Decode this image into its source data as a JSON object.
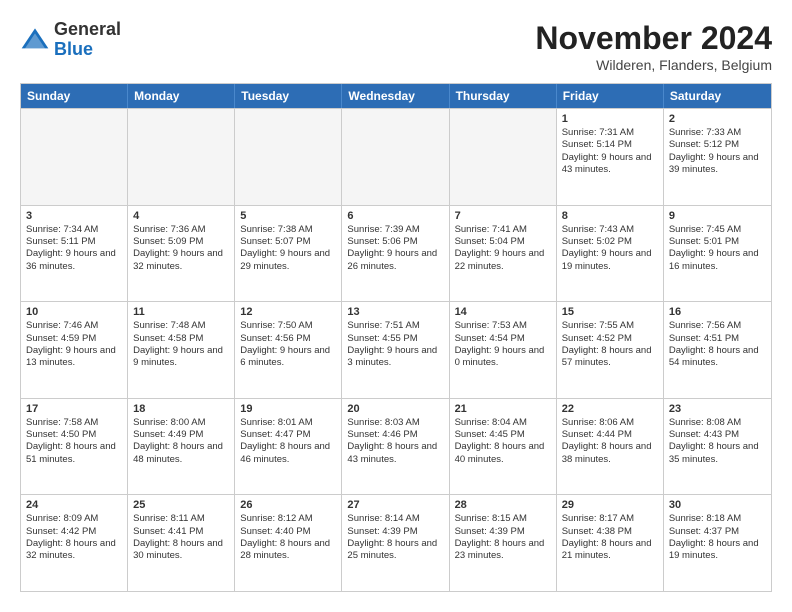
{
  "header": {
    "logo_general": "General",
    "logo_blue": "Blue",
    "month_title": "November 2024",
    "location": "Wilderen, Flanders, Belgium"
  },
  "days_of_week": [
    "Sunday",
    "Monday",
    "Tuesday",
    "Wednesday",
    "Thursday",
    "Friday",
    "Saturday"
  ],
  "rows": [
    [
      {
        "day": "",
        "empty": true
      },
      {
        "day": "",
        "empty": true
      },
      {
        "day": "",
        "empty": true
      },
      {
        "day": "",
        "empty": true
      },
      {
        "day": "",
        "empty": true
      },
      {
        "day": "1",
        "sunrise": "Sunrise: 7:31 AM",
        "sunset": "Sunset: 5:14 PM",
        "daylight": "Daylight: 9 hours and 43 minutes."
      },
      {
        "day": "2",
        "sunrise": "Sunrise: 7:33 AM",
        "sunset": "Sunset: 5:12 PM",
        "daylight": "Daylight: 9 hours and 39 minutes."
      }
    ],
    [
      {
        "day": "3",
        "sunrise": "Sunrise: 7:34 AM",
        "sunset": "Sunset: 5:11 PM",
        "daylight": "Daylight: 9 hours and 36 minutes."
      },
      {
        "day": "4",
        "sunrise": "Sunrise: 7:36 AM",
        "sunset": "Sunset: 5:09 PM",
        "daylight": "Daylight: 9 hours and 32 minutes."
      },
      {
        "day": "5",
        "sunrise": "Sunrise: 7:38 AM",
        "sunset": "Sunset: 5:07 PM",
        "daylight": "Daylight: 9 hours and 29 minutes."
      },
      {
        "day": "6",
        "sunrise": "Sunrise: 7:39 AM",
        "sunset": "Sunset: 5:06 PM",
        "daylight": "Daylight: 9 hours and 26 minutes."
      },
      {
        "day": "7",
        "sunrise": "Sunrise: 7:41 AM",
        "sunset": "Sunset: 5:04 PM",
        "daylight": "Daylight: 9 hours and 22 minutes."
      },
      {
        "day": "8",
        "sunrise": "Sunrise: 7:43 AM",
        "sunset": "Sunset: 5:02 PM",
        "daylight": "Daylight: 9 hours and 19 minutes."
      },
      {
        "day": "9",
        "sunrise": "Sunrise: 7:45 AM",
        "sunset": "Sunset: 5:01 PM",
        "daylight": "Daylight: 9 hours and 16 minutes."
      }
    ],
    [
      {
        "day": "10",
        "sunrise": "Sunrise: 7:46 AM",
        "sunset": "Sunset: 4:59 PM",
        "daylight": "Daylight: 9 hours and 13 minutes."
      },
      {
        "day": "11",
        "sunrise": "Sunrise: 7:48 AM",
        "sunset": "Sunset: 4:58 PM",
        "daylight": "Daylight: 9 hours and 9 minutes."
      },
      {
        "day": "12",
        "sunrise": "Sunrise: 7:50 AM",
        "sunset": "Sunset: 4:56 PM",
        "daylight": "Daylight: 9 hours and 6 minutes."
      },
      {
        "day": "13",
        "sunrise": "Sunrise: 7:51 AM",
        "sunset": "Sunset: 4:55 PM",
        "daylight": "Daylight: 9 hours and 3 minutes."
      },
      {
        "day": "14",
        "sunrise": "Sunrise: 7:53 AM",
        "sunset": "Sunset: 4:54 PM",
        "daylight": "Daylight: 9 hours and 0 minutes."
      },
      {
        "day": "15",
        "sunrise": "Sunrise: 7:55 AM",
        "sunset": "Sunset: 4:52 PM",
        "daylight": "Daylight: 8 hours and 57 minutes."
      },
      {
        "day": "16",
        "sunrise": "Sunrise: 7:56 AM",
        "sunset": "Sunset: 4:51 PM",
        "daylight": "Daylight: 8 hours and 54 minutes."
      }
    ],
    [
      {
        "day": "17",
        "sunrise": "Sunrise: 7:58 AM",
        "sunset": "Sunset: 4:50 PM",
        "daylight": "Daylight: 8 hours and 51 minutes."
      },
      {
        "day": "18",
        "sunrise": "Sunrise: 8:00 AM",
        "sunset": "Sunset: 4:49 PM",
        "daylight": "Daylight: 8 hours and 48 minutes."
      },
      {
        "day": "19",
        "sunrise": "Sunrise: 8:01 AM",
        "sunset": "Sunset: 4:47 PM",
        "daylight": "Daylight: 8 hours and 46 minutes."
      },
      {
        "day": "20",
        "sunrise": "Sunrise: 8:03 AM",
        "sunset": "Sunset: 4:46 PM",
        "daylight": "Daylight: 8 hours and 43 minutes."
      },
      {
        "day": "21",
        "sunrise": "Sunrise: 8:04 AM",
        "sunset": "Sunset: 4:45 PM",
        "daylight": "Daylight: 8 hours and 40 minutes."
      },
      {
        "day": "22",
        "sunrise": "Sunrise: 8:06 AM",
        "sunset": "Sunset: 4:44 PM",
        "daylight": "Daylight: 8 hours and 38 minutes."
      },
      {
        "day": "23",
        "sunrise": "Sunrise: 8:08 AM",
        "sunset": "Sunset: 4:43 PM",
        "daylight": "Daylight: 8 hours and 35 minutes."
      }
    ],
    [
      {
        "day": "24",
        "sunrise": "Sunrise: 8:09 AM",
        "sunset": "Sunset: 4:42 PM",
        "daylight": "Daylight: 8 hours and 32 minutes."
      },
      {
        "day": "25",
        "sunrise": "Sunrise: 8:11 AM",
        "sunset": "Sunset: 4:41 PM",
        "daylight": "Daylight: 8 hours and 30 minutes."
      },
      {
        "day": "26",
        "sunrise": "Sunrise: 8:12 AM",
        "sunset": "Sunset: 4:40 PM",
        "daylight": "Daylight: 8 hours and 28 minutes."
      },
      {
        "day": "27",
        "sunrise": "Sunrise: 8:14 AM",
        "sunset": "Sunset: 4:39 PM",
        "daylight": "Daylight: 8 hours and 25 minutes."
      },
      {
        "day": "28",
        "sunrise": "Sunrise: 8:15 AM",
        "sunset": "Sunset: 4:39 PM",
        "daylight": "Daylight: 8 hours and 23 minutes."
      },
      {
        "day": "29",
        "sunrise": "Sunrise: 8:17 AM",
        "sunset": "Sunset: 4:38 PM",
        "daylight": "Daylight: 8 hours and 21 minutes."
      },
      {
        "day": "30",
        "sunrise": "Sunrise: 8:18 AM",
        "sunset": "Sunset: 4:37 PM",
        "daylight": "Daylight: 8 hours and 19 minutes."
      }
    ]
  ]
}
